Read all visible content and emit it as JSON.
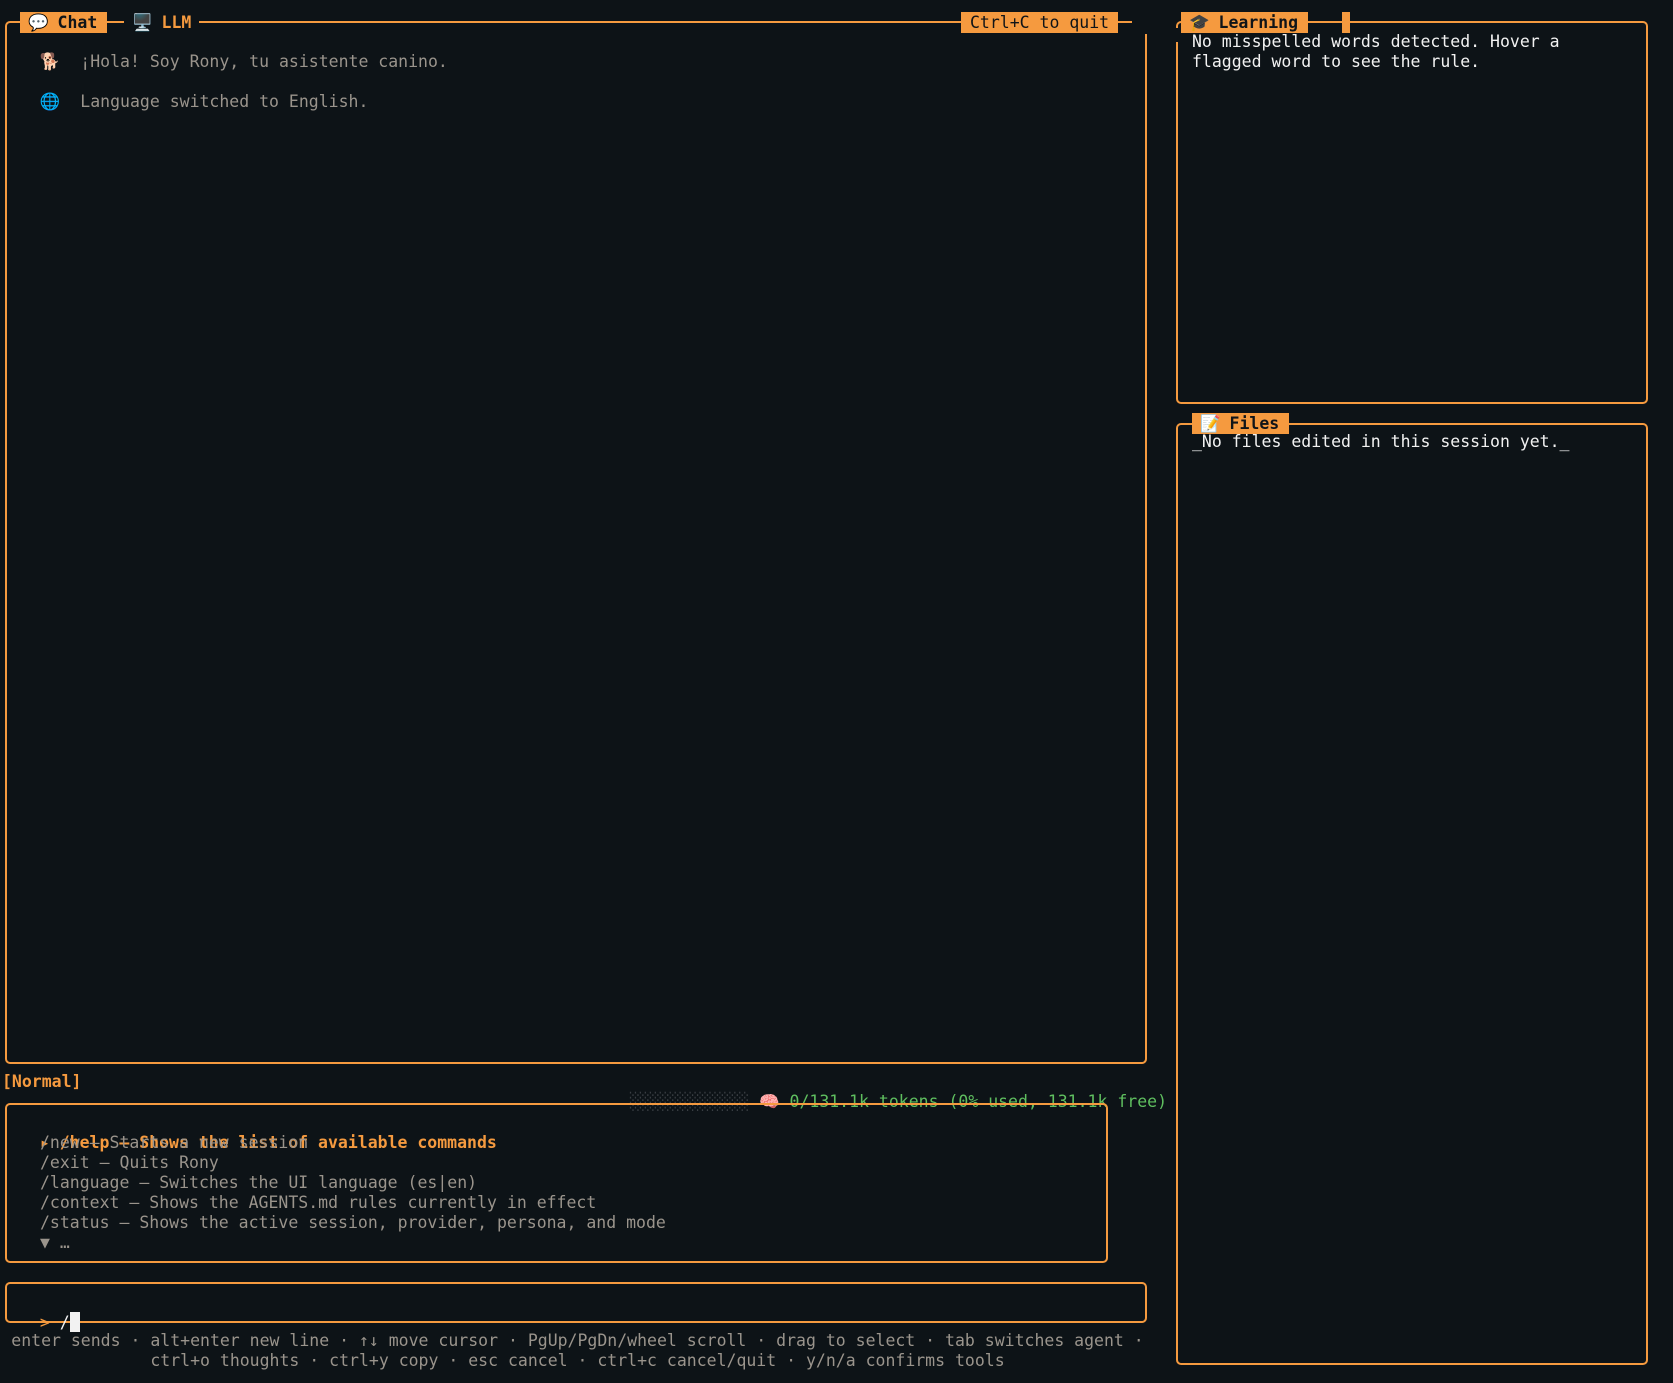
{
  "chat": {
    "tab_icon": "speech-bubble-icon",
    "tab_glyph": "💬",
    "tab_label": "Chat",
    "llm_icon": "desktop-computer-icon",
    "llm_glyph": "🖥️",
    "llm_label": "LLM",
    "quit_hint": "Ctrl+C to quit",
    "messages": [
      {
        "icon": "dog-icon",
        "glyph": "🐕",
        "text": "¡Hola! Soy Rony, tu asistente canino."
      },
      {
        "icon": "globe-icon",
        "glyph": "🌐",
        "text": "Language switched to English."
      }
    ]
  },
  "status": {
    "mode": "[Normal]",
    "meter": "░░░░░░░░░░░░",
    "brain_icon": "brain-icon",
    "brain_glyph": "🧠",
    "tokens": "0/131.1k tokens (0% used, 131.1k free)"
  },
  "commands": {
    "selected_marker": "▸",
    "items": [
      {
        "text": "/help — Shows the list of available commands",
        "selected": true
      },
      {
        "text": "/new — Starts a new session",
        "selected": false
      },
      {
        "text": "/exit — Quits Rony",
        "selected": false
      },
      {
        "text": "/language — Switches the UI language (es|en)",
        "selected": false
      },
      {
        "text": "/context — Shows the AGENTS.md rules currently in effect",
        "selected": false
      },
      {
        "text": "/status — Shows the active session, provider, persona, and mode",
        "selected": false
      }
    ],
    "more": "▼ …"
  },
  "input": {
    "prompt": ">",
    "value": "/"
  },
  "footer": {
    "line1": "enter sends · alt+enter new line · ↑↓ move cursor · PgUp/PgDn/wheel scroll · drag to select · tab switches agent ·",
    "line2": "ctrl+o thoughts · ctrl+y copy · esc cancel · ctrl+c cancel/quit · y/n/a confirms tools"
  },
  "learning": {
    "tab_icon": "graduation-cap-icon",
    "tab_glyph": "🎓",
    "tab_label": "Learning",
    "line1": "No misspelled words detected. Hover a",
    "line2": "flagged word to see the rule."
  },
  "files": {
    "tab_icon": "memo-icon",
    "tab_glyph": "📝",
    "tab_label": "Files",
    "empty": "_No files edited in this session yet._"
  },
  "colors": {
    "background": "#0d1317",
    "accent": "#f59a3f",
    "muted_text": "#9a948c",
    "bright_text": "#f2f2f2",
    "token_green": "#5fbf5f"
  }
}
